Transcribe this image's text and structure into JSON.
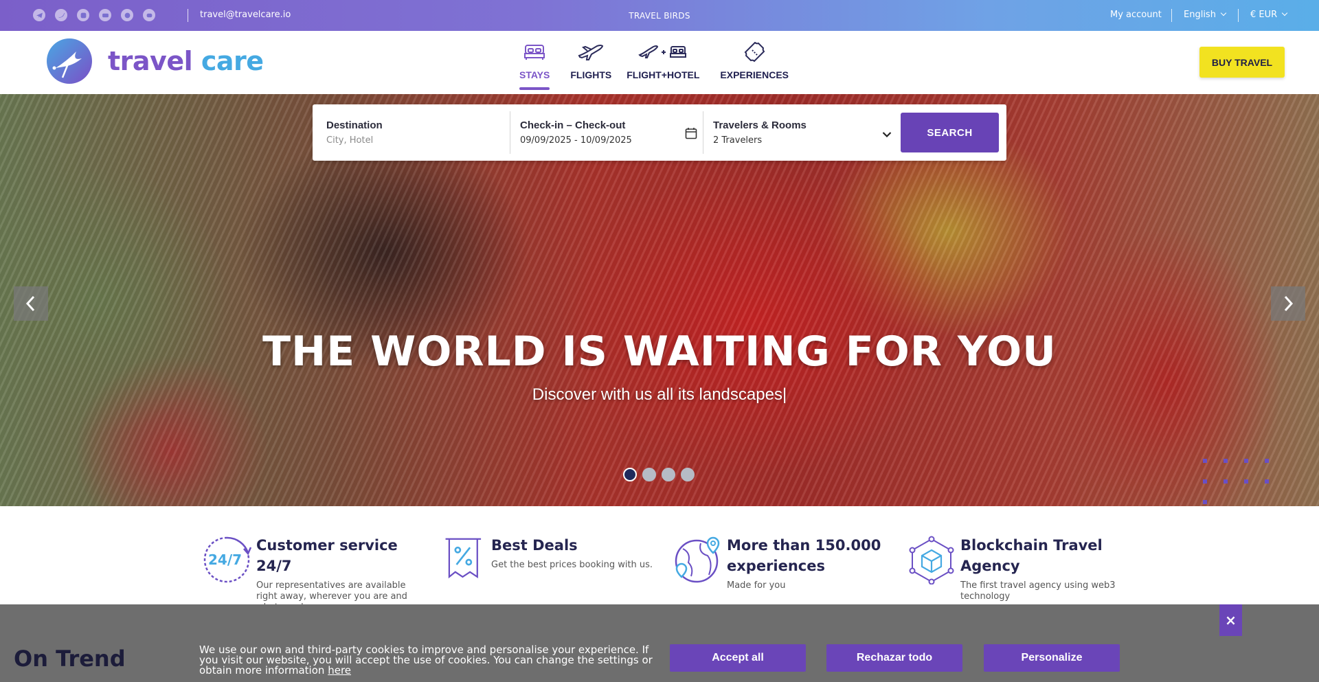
{
  "topbar": {
    "socials": [
      {
        "icon": "telegram-icon"
      },
      {
        "icon": "twitter-icon"
      },
      {
        "icon": "instagram-icon"
      },
      {
        "icon": "youtube-icon"
      },
      {
        "icon": "github-icon"
      },
      {
        "icon": "discord-icon"
      }
    ],
    "email": "travel@travelcare.io",
    "center_text": "TRAVEL BIRDS",
    "my_account": "My account",
    "language": "English",
    "currency": "€ EUR"
  },
  "header": {
    "logo_part1": "travel",
    "logo_part2": "care",
    "nav": [
      {
        "label": "STAYS",
        "icon": "bed-icon",
        "active": true
      },
      {
        "label": "FLIGHTS",
        "icon": "plane-icon",
        "active": false
      },
      {
        "label": "FLIGHT+HOTEL",
        "icon": "plane-plus-bed-icon",
        "active": false
      },
      {
        "label": "EXPERIENCES",
        "icon": "ticket-icon",
        "active": false
      }
    ],
    "buy_label": "BUY TRAVEL"
  },
  "search": {
    "destination_label": "Destination",
    "destination_placeholder": "City, Hotel",
    "dates_label": "Check-in – Check-out",
    "dates_value": "09/09/2025 - 10/09/2025",
    "travelers_label": "Travelers & Rooms",
    "travelers_value": "2 Travelers",
    "button_label": "SEARCH"
  },
  "hero": {
    "title": "THE WORLD IS WAITING FOR YOU",
    "subtitle": "Discover with us all its landscapes|",
    "slides_count": 4,
    "active_slide": 1
  },
  "features": [
    {
      "icon": "clock-24-7-icon",
      "title": "Customer service 24/7",
      "desc": "Our representatives are available right away, wherever you are and whatever happens."
    },
    {
      "icon": "discount-tag-icon",
      "title": "Best Deals",
      "desc": "Get the best prices booking with us."
    },
    {
      "icon": "globe-pin-icon",
      "title": "More than 150.000 experiences",
      "desc": "Made for you"
    },
    {
      "icon": "blockchain-cube-icon",
      "title": "Blockchain Travel Agency",
      "desc": "The first travel agency using web3 technology"
    }
  ],
  "section": {
    "on_trend": "On Trend"
  },
  "cookie": {
    "text": "We use our own and third-party cookies to improve and personalise your experience. If you visit our website, you will accept the use of cookies. You can change the settings or obtain more information",
    "link": "here",
    "accept": "Accept all",
    "reject": "Rechazar todo",
    "personalize": "Personalize",
    "close": "×"
  },
  "colors": {
    "brand_purple": "#6843b6",
    "brand_blue": "#45a9e2",
    "buy_yellow": "#f2e220"
  }
}
